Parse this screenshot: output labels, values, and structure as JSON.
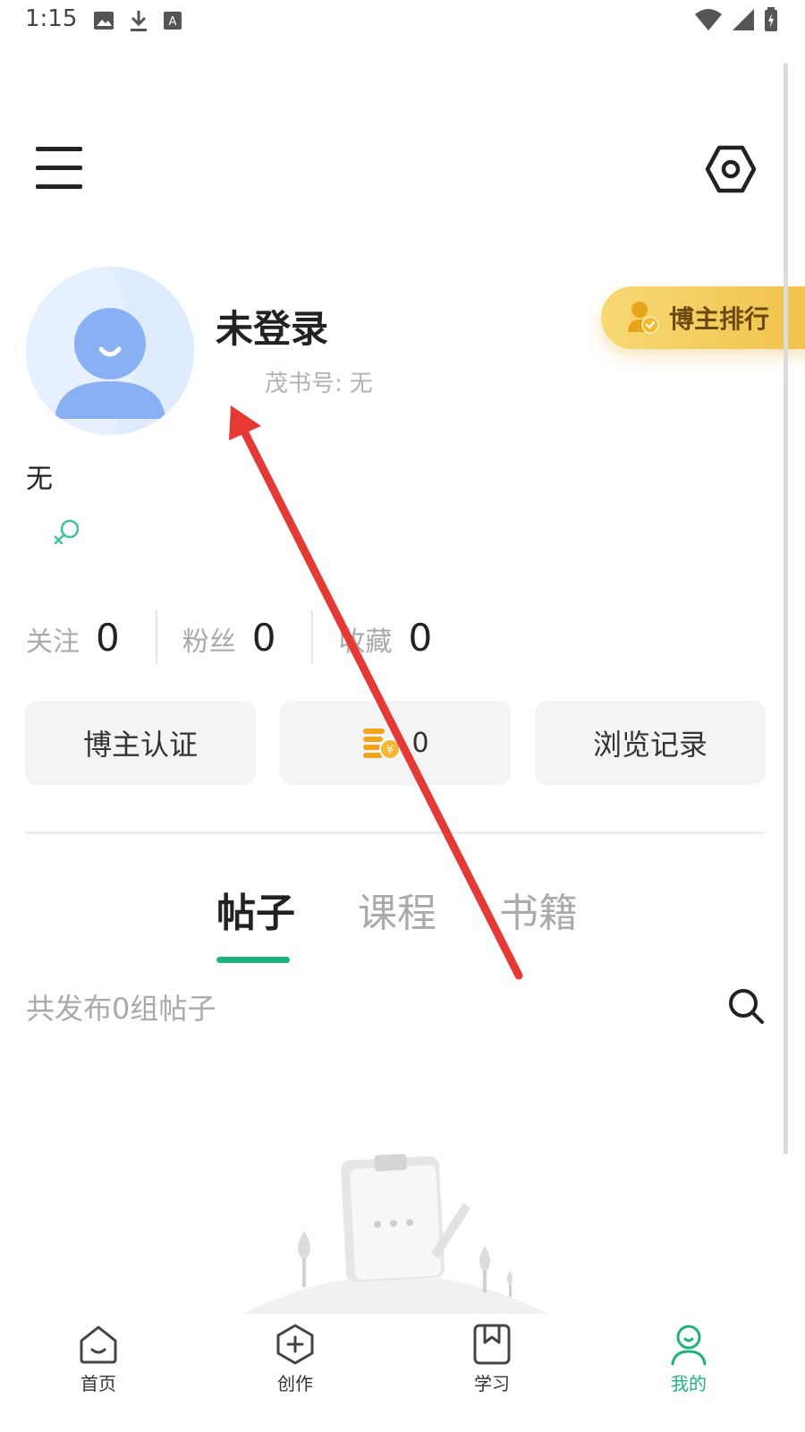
{
  "status_bar": {
    "time": "1:15"
  },
  "profile": {
    "username": "未登录",
    "id_label": "茂书号:",
    "id_value": "无",
    "bio": "无",
    "rank_label": "博主排行"
  },
  "stats": [
    {
      "label": "关注",
      "value": "0"
    },
    {
      "label": "粉丝",
      "value": "0"
    },
    {
      "label": "收藏",
      "value": "0"
    }
  ],
  "actions": {
    "certify": "博主认证",
    "coins": "0",
    "history": "浏览记录"
  },
  "tabs": [
    {
      "label": "帖子",
      "active": true
    },
    {
      "label": "课程",
      "active": false
    },
    {
      "label": "书籍",
      "active": false
    }
  ],
  "posts": {
    "count_text": "共发布0组帖子"
  },
  "bottom_nav": [
    {
      "label": "首页",
      "icon": "home-icon"
    },
    {
      "label": "创作",
      "icon": "create-icon"
    },
    {
      "label": "学习",
      "icon": "bookmark-icon"
    },
    {
      "label": "我的",
      "icon": "profile-icon",
      "active": true
    }
  ],
  "colors": {
    "accent": "#1fb082",
    "rank_gold": "#f0c24c",
    "arrow": "#e53935"
  }
}
